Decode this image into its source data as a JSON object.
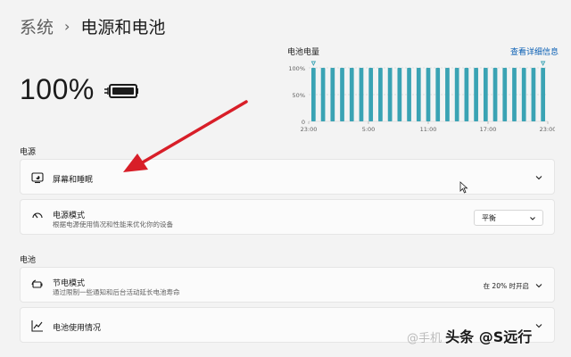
{
  "breadcrumb": {
    "root": "系统",
    "separator": "›",
    "current": "电源和电池"
  },
  "battery": {
    "percent": "100%",
    "level": 1.0
  },
  "chart_data": {
    "type": "bar",
    "title": "电池电量",
    "link": "查看详细信息",
    "y_ticks": [
      "100%",
      "50%",
      "0"
    ],
    "ylim": [
      0,
      100
    ],
    "x_ticks": [
      "23:00",
      "5:00",
      "11:00",
      "17:00",
      "23:00"
    ],
    "values": [
      100,
      100,
      100,
      100,
      100,
      100,
      100,
      100,
      100,
      100,
      100,
      100,
      100,
      100,
      100,
      100,
      100,
      100,
      100,
      100,
      100,
      100,
      100,
      100,
      100
    ],
    "markers": [
      "first",
      "last"
    ],
    "colors": {
      "bar": "#3aa3b4",
      "grid": "#d8d8d8",
      "marker": "#3aa3b4"
    }
  },
  "power": {
    "section": "电源",
    "screen_sleep": {
      "title": "屏幕和睡眠"
    },
    "power_mode": {
      "title": "电源模式",
      "desc": "根据电源使用情况和性能来优化你的设备",
      "value": "平衡"
    }
  },
  "battery_section": {
    "section": "电池",
    "saver": {
      "title": "节电模式",
      "desc": "通过限制一些通知和后台活动延长电池寿命",
      "status": "在 20% 时开启"
    },
    "usage": {
      "title": "电池使用情况"
    }
  },
  "watermark": {
    "muted": "@手机",
    "strong": "头条 @S远行"
  },
  "colors": {
    "accent": "#0a5fb4",
    "arrow": "#d81e28"
  }
}
